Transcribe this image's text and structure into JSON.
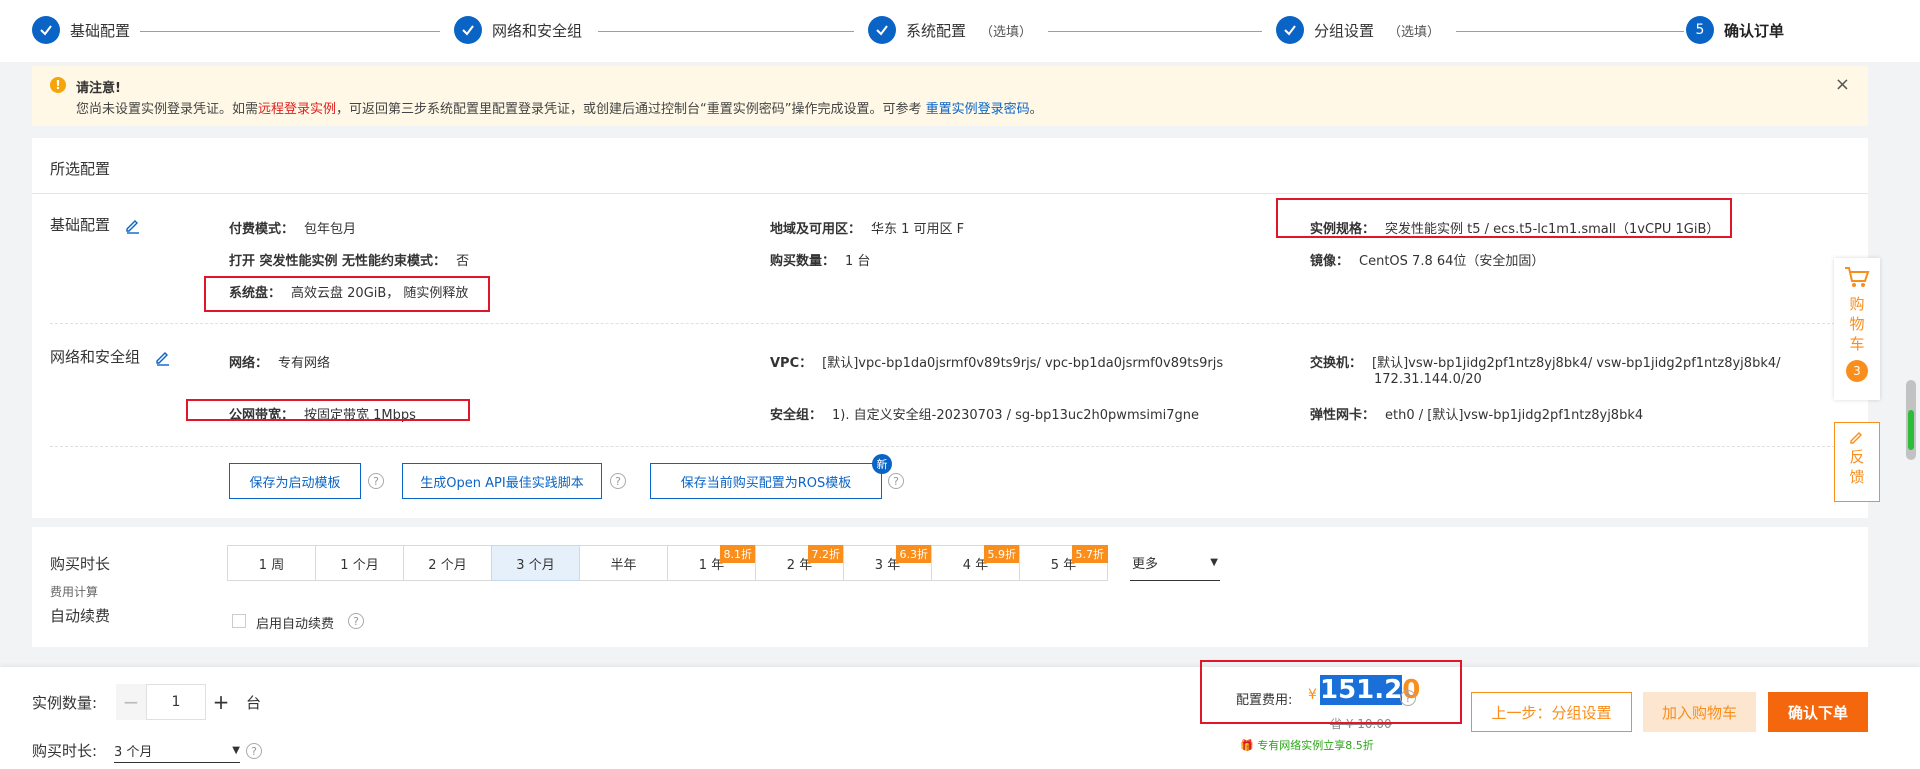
{
  "stepper": {
    "steps": [
      {
        "label": "基础配置",
        "optional": "",
        "icon": "check-icon",
        "number": ""
      },
      {
        "label": "网络和安全组",
        "optional": "",
        "icon": "check-icon",
        "number": ""
      },
      {
        "label": "系统配置",
        "optional": "（选填）",
        "icon": "check-icon",
        "number": ""
      },
      {
        "label": "分组设置",
        "optional": "（选填）",
        "icon": "check-icon",
        "number": ""
      },
      {
        "label": "确认订单",
        "optional": "",
        "icon": "",
        "number": "5"
      }
    ]
  },
  "notice": {
    "title": "请注意!",
    "text_1": "您尚未设置实例登录凭证。如需",
    "link_1": "远程登录实例",
    "text_2": "，可返回第三步系统配置里配置登录凭证，或创建后通过控制台“重置实例密码”操作完成设置。可参考",
    "link_2": "重置实例登录密码",
    "text_3": "。",
    "close": "×"
  },
  "config": {
    "title": "所选配置",
    "basic": {
      "label": "基础配置",
      "billing_key": "付费模式：",
      "billing_val": "包年包月",
      "region_key": "地域及可用区：",
      "region_val": "华东 1 可用区 F",
      "spec_key": "实例规格：",
      "spec_val": "突发性能实例 t5 / ecs.t5-lc1m1.small（1vCPU 1GiB）",
      "burst_key": "打开 突发性能实例 无性能约束模式：",
      "burst_val": "否",
      "qty_key": "购买数量：",
      "qty_val": "1 台",
      "image_key": "镜像：",
      "image_val": "CentOS 7.8 64位（安全加固）",
      "disk_key": "系统盘：",
      "disk_val": "高效云盘 20GiB， 随实例释放"
    },
    "network": {
      "label": "网络和安全组",
      "net_key": "网络：",
      "net_val": "专有网络",
      "vpc_key": "VPC：",
      "vpc_val": "[默认]vpc-bp1da0jsrmf0v89ts9rjs/ vpc-bp1da0jsrmf0v89ts9rjs",
      "vsw_key": "交换机：",
      "vsw_val_1": "[默认]vsw-bp1jidg2pf1ntz8yj8bk4/ vsw-bp1jidg2pf1ntz8yj8bk4/",
      "vsw_val_2": "172.31.144.0/20",
      "bw_key": "公网带宽：",
      "bw_val": "按固定带宽 1Mbps",
      "sg_key": "安全组：",
      "sg_val": "1). 自定义安全组-20230703 / sg-bp13uc2h0pwmsimi7gne",
      "eni_key": "弹性网卡：",
      "eni_val": "eth0 / [默认]vsw-bp1jidg2pf1ntz8yj8bk4"
    },
    "actions": {
      "save_template": "保存为启动模板",
      "gen_api": "生成Open API最佳实践脚本",
      "save_ros": "保存当前购买配置为ROS模板",
      "new_badge": "新",
      "help": "?"
    }
  },
  "duration": {
    "label": "购买时长",
    "fee_calc": "费用计算",
    "auto_renew_label": "自动续费",
    "auto_renew_checkbox": "启用自动续费",
    "tabs": [
      {
        "label": "1 周",
        "discount": ""
      },
      {
        "label": "1 个月",
        "discount": ""
      },
      {
        "label": "2 个月",
        "discount": ""
      },
      {
        "label": "3 个月",
        "discount": "",
        "selected": true
      },
      {
        "label": "半年",
        "discount": ""
      },
      {
        "label": "1 年",
        "discount": "8.1折"
      },
      {
        "label": "2 年",
        "discount": "7.2折"
      },
      {
        "label": "3 年",
        "discount": "6.3折"
      },
      {
        "label": "4 年",
        "discount": "5.9折"
      },
      {
        "label": "5 年",
        "discount": "5.7折"
      }
    ],
    "more": "更多"
  },
  "bottom": {
    "qty_label": "实例数量:",
    "qty_value": "1",
    "qty_unit": "台",
    "dur_label": "购买时长:",
    "dur_value": "3 个月",
    "price_label": "配置费用:",
    "price_currency": "¥",
    "price_highlight": "151.2",
    "price_rest": "0",
    "price_orig": "省 ¥ 10.00",
    "promo": "专有网络实例立享8.5折",
    "prev_btn": "上一步：分组设置",
    "cart_btn": "加入购物车",
    "order_btn": "确认下单"
  },
  "float": {
    "cart_text": "购物车",
    "cart_count": "3",
    "feedback_text": "反馈"
  },
  "colors": {
    "primary": "#0a64c6",
    "accent": "#f98e1c",
    "annotation": "#e0162b"
  }
}
